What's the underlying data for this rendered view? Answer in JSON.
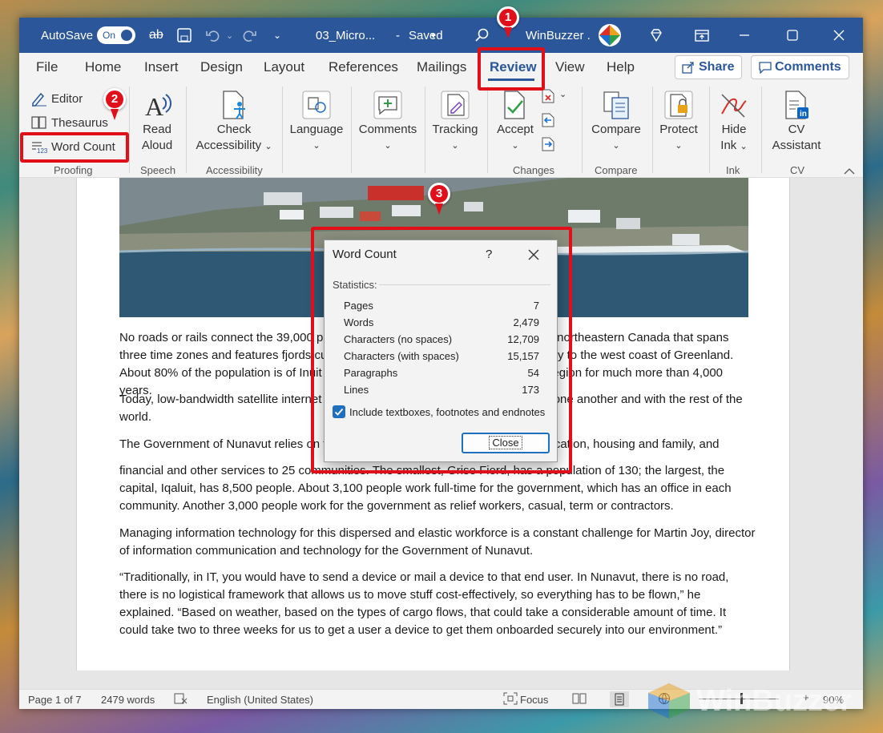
{
  "titlebar": {
    "autosave": "AutoSave",
    "toggle": "On",
    "doc": "03_Micro...",
    "sep": "-",
    "saved": "Saved",
    "user": "WinBuzzer ."
  },
  "menu": {
    "file": "File",
    "home": "Home",
    "insert": "Insert",
    "design": "Design",
    "layout": "Layout",
    "references": "References",
    "mailings": "Mailings",
    "review": "Review",
    "view": "View",
    "help": "Help",
    "share": "Share",
    "comments": "Comments"
  },
  "ribbon": {
    "editor": "Editor",
    "thesaurus": "Thesaurus",
    "word_count": "Word Count",
    "proofing": "Proofing",
    "read": "Read",
    "aloud": "Aloud",
    "speech": "Speech",
    "check": "Check",
    "accessibility_btn": "Accessibility",
    "accessibility": "Accessibility",
    "language": "Language",
    "comments": "Comments",
    "tracking": "Tracking",
    "accept": "Accept",
    "changes": "Changes",
    "compare_btn": "Compare",
    "compare": "Compare",
    "protect": "Protect",
    "hide": "Hide",
    "ink_btn": "Ink",
    "ink": "Ink",
    "cv": "CV",
    "assistant": "Assistant",
    "cv_group": "CV"
  },
  "document": {
    "paragraphs": [
      "No roads or rails connect the 39,000 people that live in Nunavut, a vast territory in northeastern Canada that spans three time zones and features fjords cut into the Arctic Ocean, extending all the way to the west coast of Greenland. About 80% of the population is of Inuit descent, a people that have inhabited the region for much more than 4,000 years.",
      "Today, low-bandwidth satellite internet is how the people of Nunavut connect with one another and with the rest of the world.",
      "The Government of Nunavut relies on technology to provide access to health, education, housing and family, and",
      "financial and other services to 25 communities. The smallest, Grise Fiord, has a population of 130; the largest, the capital, Iqaluit, has 8,500 people. About 3,100 people work full-time for the government, which has an office in each community. Another 3,000 people work for the government as relief workers, casual, term or contractors.",
      "Managing information technology for this dispersed and elastic workforce is a constant challenge for Martin Joy, director of information communication and technology for the Government of Nunavut.",
      "“Traditionally, in IT, you would have to send a device or mail a device to that end user. In Nunavut, there is no road, there is no logistical framework that allows us to move stuff cost-effectively, so everything has to be flown,” he explained. “Based on weather, based on the types of cargo flows, that could take a considerable amount of time. It could take two to three weeks for us to get a user a device to get them onboarded securely into our environment.”"
    ]
  },
  "dialog": {
    "title": "Word Count",
    "help": "?",
    "statistics": "Statistics:",
    "rows": [
      {
        "label": "Pages",
        "value": "7"
      },
      {
        "label": "Words",
        "value": "2,479"
      },
      {
        "label": "Characters (no spaces)",
        "value": "12,709"
      },
      {
        "label": "Characters (with spaces)",
        "value": "15,157"
      },
      {
        "label": "Paragraphs",
        "value": "54"
      },
      {
        "label": "Lines",
        "value": "173"
      }
    ],
    "checkbox_label": "Include textboxes, footnotes and endnotes",
    "checkbox_checked": true,
    "close": "Close"
  },
  "status": {
    "page": "Page 1 of 7",
    "words": "2479 words",
    "language": "English (United States)",
    "focus": "Focus",
    "zoom": "90%"
  },
  "markers": {
    "m1": "1",
    "m2": "2",
    "m3": "3"
  },
  "watermark": "WinBuzzer",
  "colors": {
    "word_blue": "#2b579a",
    "highlight_red": "#e10f1a"
  }
}
